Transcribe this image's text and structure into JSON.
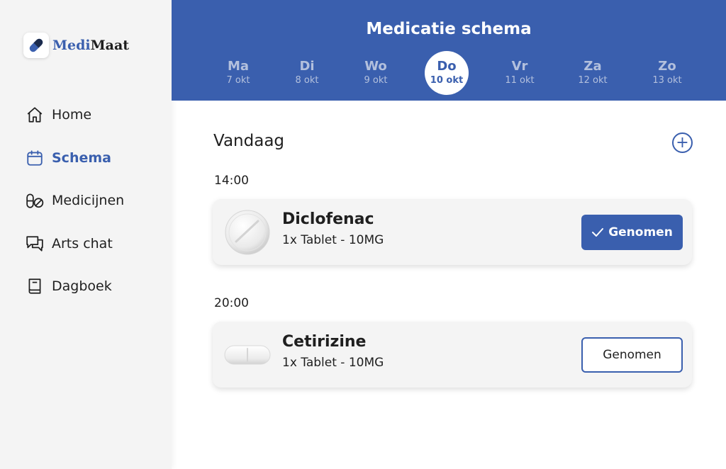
{
  "app": {
    "logo_part1": "Medi",
    "logo_part2": "Maat",
    "brand_color": "#3a5fae"
  },
  "sidebar": {
    "items": [
      {
        "label": "Home",
        "icon": "home-icon",
        "active": false
      },
      {
        "label": "Schema",
        "icon": "calendar-icon",
        "active": true
      },
      {
        "label": "Medicijnen",
        "icon": "pills-icon",
        "active": false
      },
      {
        "label": "Arts chat",
        "icon": "chat-icon",
        "active": false
      },
      {
        "label": "Dagboek",
        "icon": "book-icon",
        "active": false
      }
    ]
  },
  "header": {
    "title": "Medicatie schema",
    "days": [
      {
        "name": "Ma",
        "date": "7 okt",
        "active": false
      },
      {
        "name": "Di",
        "date": "8 okt",
        "active": false
      },
      {
        "name": "Wo",
        "date": "9 okt",
        "active": false
      },
      {
        "name": "Do",
        "date": "10 okt",
        "active": true
      },
      {
        "name": "Vr",
        "date": "11 okt",
        "active": false
      },
      {
        "name": "Za",
        "date": "12 okt",
        "active": false
      },
      {
        "name": "Zo",
        "date": "13 okt",
        "active": false
      }
    ]
  },
  "main": {
    "section_title": "Vandaag",
    "add_symbol": "+",
    "slots": [
      {
        "time": "14:00",
        "medicine": "Diclofenac",
        "dose": "1x Tablet - 10MG",
        "pill": "round-tablet",
        "button_label": "Genomen",
        "taken": true
      },
      {
        "time": "20:00",
        "medicine": "Cetirizine",
        "dose": "1x Tablet - 10MG",
        "pill": "oblong-tablet",
        "button_label": "Genomen",
        "taken": false
      }
    ]
  }
}
